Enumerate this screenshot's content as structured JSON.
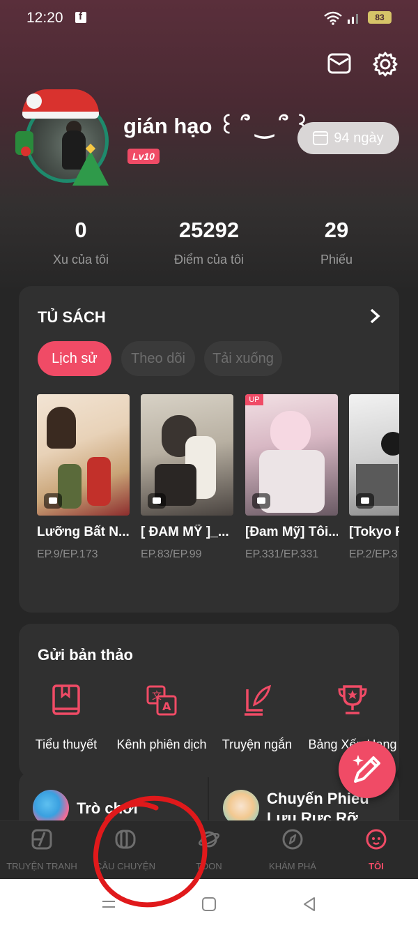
{
  "status_bar": {
    "time": "12:20",
    "battery": "83"
  },
  "profile": {
    "username": "gián hạo ꒰ ՞ ‿ ՞ ꒱ ...",
    "level": "Lv10",
    "days": "94 ngày"
  },
  "stats": [
    {
      "value": "0",
      "label": "Xu của tôi"
    },
    {
      "value": "25292",
      "label": "Điểm của tôi"
    },
    {
      "value": "29",
      "label": "Phiếu"
    }
  ],
  "bookshelf": {
    "title": "TỦ SÁCH",
    "tabs": [
      "Lịch sử",
      "Theo dõi",
      "Tải xuống"
    ],
    "books": [
      {
        "title": "Lưỡng Bất N...",
        "episode": "EP.9/EP.173"
      },
      {
        "title": "[ ĐAM MỸ ]_...",
        "episode": "EP.83/EP.99"
      },
      {
        "title": "[Đam Mỹ] Tôi...",
        "episode": "EP.331/EP.331",
        "badge": "UP"
      },
      {
        "title": "[Tokyo R",
        "episode": "EP.2/EP.3"
      }
    ]
  },
  "submit": {
    "title": "Gửi bản thảo",
    "items": [
      "Tiểu thuyết",
      "Kênh phiên dịch",
      "Truyện ngắn",
      "Bảng Xếp Hạng"
    ]
  },
  "promos": [
    {
      "text": "Trò chơi"
    },
    {
      "text_line1": "Chuyến Phiêu",
      "text_line2": "Lưu Rực Rỡ"
    }
  ],
  "bottom_nav": [
    "TRUYỆN TRANH",
    "CÂU CHUYỆN",
    "TOON",
    "KHÁM PHÁ",
    "TÔI"
  ],
  "colors": {
    "accent": "#f04b66",
    "background": "#262626",
    "card": "#303030"
  }
}
